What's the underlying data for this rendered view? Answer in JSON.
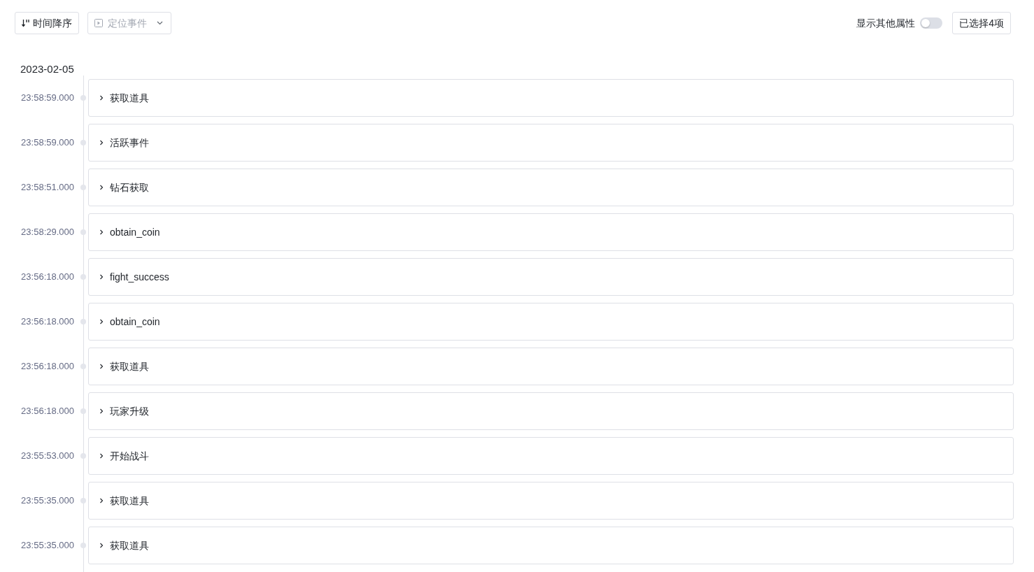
{
  "toolbar": {
    "sort_button": "时间降序",
    "event_select": {
      "placeholder": "定位事件"
    },
    "toggle": {
      "label": "显示其他属性",
      "on": false
    },
    "selection_button": "已选择4项"
  },
  "date": "2023-02-05",
  "events": [
    {
      "time": "23:58:59.000",
      "name": "获取道具",
      "expanded": false
    },
    {
      "time": "23:58:59.000",
      "name": "活跃事件",
      "expanded": false
    },
    {
      "time": "23:58:51.000",
      "name": "钻石获取",
      "expanded": false
    },
    {
      "time": "23:58:29.000",
      "name": "obtain_coin",
      "expanded": false
    },
    {
      "time": "23:56:18.000",
      "name": "fight_success",
      "expanded": false
    },
    {
      "time": "23:56:18.000",
      "name": "obtain_coin",
      "expanded": false
    },
    {
      "time": "23:56:18.000",
      "name": "获取道具",
      "expanded": false
    },
    {
      "time": "23:56:18.000",
      "name": "玩家升级",
      "expanded": false
    },
    {
      "time": "23:55:53.000",
      "name": "开始战斗",
      "expanded": false
    },
    {
      "time": "23:55:35.000",
      "name": "获取道具",
      "expanded": false
    },
    {
      "time": "23:55:35.000",
      "name": "获取道具",
      "expanded": false
    }
  ]
}
